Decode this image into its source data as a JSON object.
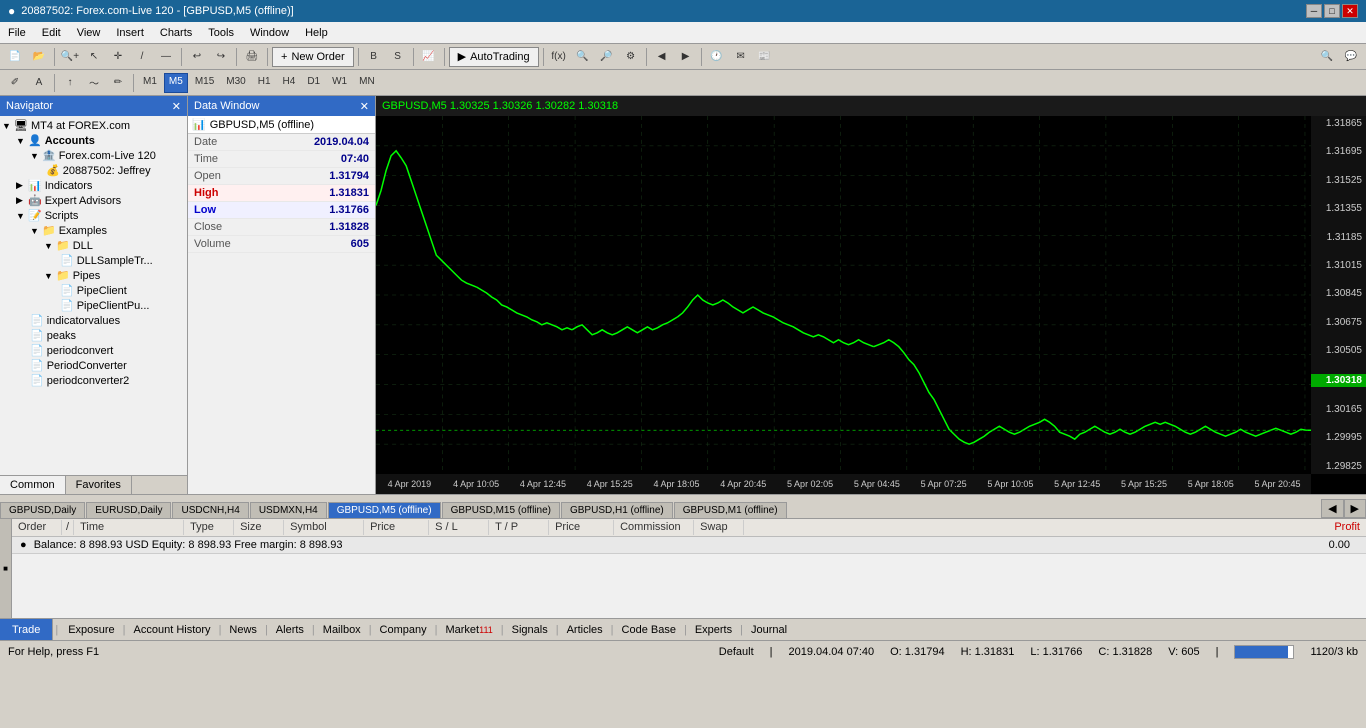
{
  "titlebar": {
    "title": "20887502: Forex.com-Live 120 - [GBPUSD,M5 (offline)]",
    "app_icon": "●"
  },
  "menubar": {
    "items": [
      "File",
      "Edit",
      "View",
      "Insert",
      "Charts",
      "Tools",
      "Window",
      "Help"
    ]
  },
  "toolbar": {
    "periods": [
      "M1",
      "M5",
      "M15",
      "M30",
      "H1",
      "H4",
      "D1",
      "W1",
      "MN"
    ],
    "active_period": "M5",
    "new_order_label": "New Order",
    "autotrading_label": "AutoTrading"
  },
  "navigator": {
    "title": "Navigator",
    "mt4_account": "MT4 at FOREX.com",
    "accounts_label": "Accounts",
    "broker_label": "Forex.com-Live 120",
    "account_user": "20887502: Jeffrey",
    "indicators_label": "Indicators",
    "expert_advisors_label": "Expert Advisors",
    "scripts_label": "Scripts",
    "examples_label": "Examples",
    "dll_label": "DLL",
    "dll_sample_label": "DLLSampleTr...",
    "pipes_label": "Pipes",
    "pipe_client_label": "PipeClient",
    "pipe_client_pu_label": "PipeClientPu...",
    "indicatorvalues_label": "indicatorvalues",
    "peaks_label": "peaks",
    "periodconvert_label": "periodconvert",
    "period_converter_label": "PeriodConverter",
    "period_converter2_label": "periodconverter2",
    "tabs": [
      "Common",
      "Favorites"
    ]
  },
  "data_window": {
    "title": "Data Window",
    "symbol": "GBPUSD,M5 (offline)",
    "rows": [
      {
        "label": "Date",
        "value": "2019.04.04"
      },
      {
        "label": "Time",
        "value": "07:40"
      },
      {
        "label": "Open",
        "value": "1.31794"
      },
      {
        "label": "High",
        "value": "1.31831",
        "highlight": "red"
      },
      {
        "label": "Low",
        "value": "1.31766",
        "highlight": "blue"
      },
      {
        "label": "Close",
        "value": "1.31828"
      },
      {
        "label": "Volume",
        "value": "605"
      }
    ]
  },
  "chart": {
    "header": "GBPUSD,M5  1.30325  1.30326  1.30282  1.30318",
    "current_price": "1.30318",
    "price_levels": [
      "1.31865",
      "1.31695",
      "1.31525",
      "1.31355",
      "1.31185",
      "1.31015",
      "1.30845",
      "1.30675",
      "1.30505",
      "1.30165",
      "1.29995",
      "1.29825"
    ],
    "time_labels": [
      "4 Apr 2019",
      "4 Apr 10:05",
      "4 Apr 12:45",
      "4 Apr 15:25",
      "4 Apr 18:05",
      "4 Apr 20:45",
      "5 Apr 02:05",
      "5 Apr 04:45",
      "5 Apr 07:25",
      "5 Apr 10:05",
      "5 Apr 12:45",
      "5 Apr 15:25",
      "5 Apr 18:05",
      "5 Apr 20:45"
    ]
  },
  "chart_tabs": {
    "tabs": [
      {
        "label": "GBPUSD,Daily",
        "active": false
      },
      {
        "label": "EURUSD,Daily",
        "active": false
      },
      {
        "label": "USDCNH,H4",
        "active": false
      },
      {
        "label": "USDMXN,H4",
        "active": false
      },
      {
        "label": "GBPUSD,M5 (offline)",
        "active": true
      },
      {
        "label": "GBPUSD,M15 (offline)",
        "active": false
      },
      {
        "label": "GBPUSD,H1 (offline)",
        "active": false
      },
      {
        "label": "GBPUSD,M1 (offline)",
        "active": false
      }
    ]
  },
  "terminal": {
    "columns": [
      "Order",
      "/",
      "Time",
      "Type",
      "Size",
      "Symbol",
      "Price",
      "S / L",
      "T / P",
      "Price",
      "Commission",
      "Swap",
      "Profit"
    ],
    "balance_text": "Balance: 8 898.93 USD  Equity: 8 898.93  Free margin: 8 898.93",
    "profit_value": "0.00"
  },
  "bottom_tabs": {
    "tabs": [
      "Trade",
      "Exposure",
      "Account History",
      "News",
      "Alerts",
      "Mailbox",
      "Company",
      "Market",
      "Signals",
      "Articles",
      "Code Base",
      "Experts",
      "Journal"
    ],
    "active": "Trade",
    "market_badge": "111"
  },
  "status_bar": {
    "help_text": "For Help, press F1",
    "default": "Default",
    "datetime": "2019.04.04 07:40",
    "open": "O: 1.31794",
    "high": "H: 1.31831",
    "low": "L: 1.31766",
    "close": "C: 1.31828",
    "volume": "V: 605",
    "progress": "1120/3 kb"
  }
}
